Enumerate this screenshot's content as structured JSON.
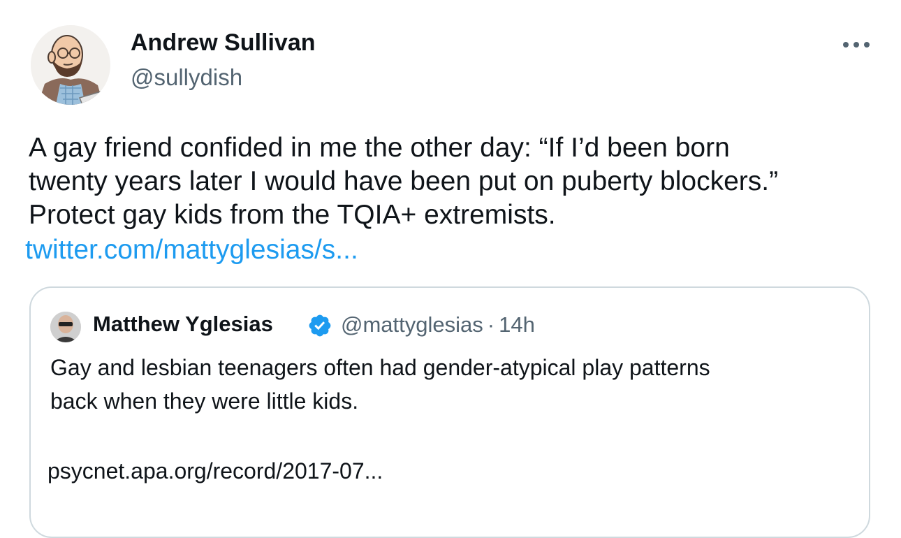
{
  "tweet": {
    "author": {
      "name": "Andrew Sullivan",
      "handle": "@sullydish"
    },
    "text_lines": [
      "A gay friend confided in me the other day: “If I’d been born",
      "twenty years later I would have been put on puberty blockers.”",
      "Protect gay kids from the TQIA+ extremists."
    ],
    "link": "twitter.com/mattyglesias/s...",
    "more_icon": "more-horizontal-icon",
    "link_color": "#1d9bf0"
  },
  "quoted": {
    "author": {
      "name": "Matthew Yglesias",
      "handle": "@mattyglesias",
      "separator": "·",
      "time": "14h"
    },
    "verified_icon": "verified-badge-icon",
    "verified_color": "#1d9bf0",
    "text_lines": [
      "Gay and lesbian teenagers often had gender-atypical play patterns",
      "back when they were little kids."
    ],
    "link": "psycnet.apa.org/record/2017-07..."
  }
}
